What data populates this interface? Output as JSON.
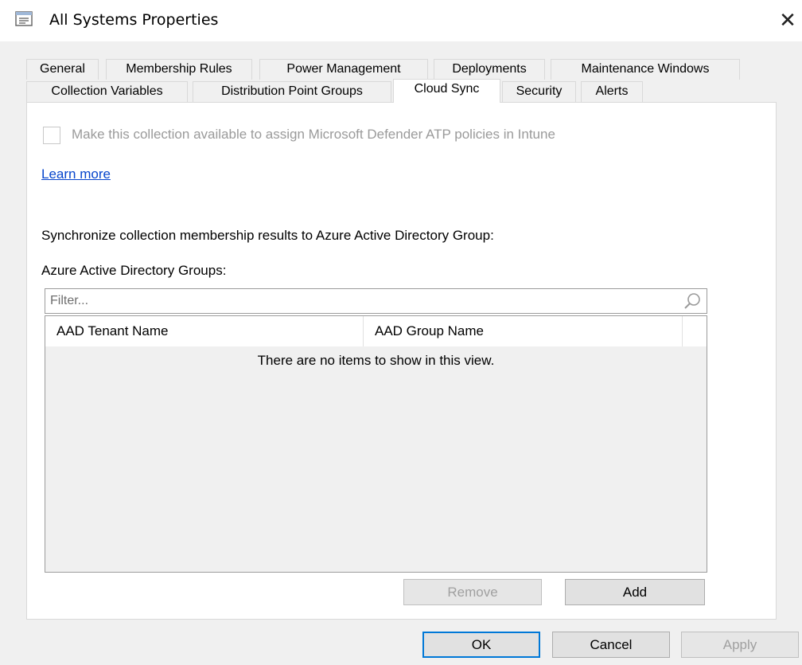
{
  "window": {
    "title": "All Systems Properties",
    "close_glyph": "✕",
    "icon": "properties-window-icon"
  },
  "tabs": {
    "row1": [
      "General",
      "Membership Rules",
      "Power Management",
      "Deployments",
      "Maintenance Windows"
    ],
    "row2": [
      "Collection Variables",
      "Distribution Point Groups",
      "Cloud Sync",
      "Security",
      "Alerts"
    ],
    "active": "Cloud Sync"
  },
  "cloud_sync": {
    "defender_checkbox_label": "Make this collection available to assign Microsoft Defender ATP policies in Intune",
    "defender_checked": false,
    "learn_more": "Learn more",
    "sync_label": "Synchronize collection membership results to Azure Active Directory Group:",
    "groups_label": "Azure Active Directory Groups:",
    "filter_placeholder": "Filter...",
    "columns": [
      "AAD Tenant Name",
      "AAD Group Name"
    ],
    "empty_message": "There are no items to show in this view.",
    "remove_button": "Remove",
    "add_button": "Add"
  },
  "footer": {
    "ok": "OK",
    "cancel": "Cancel",
    "apply": "Apply"
  },
  "colors": {
    "accent": "#0078d7",
    "link": "#0645cc",
    "disabled_text": "#9a9a9a"
  }
}
